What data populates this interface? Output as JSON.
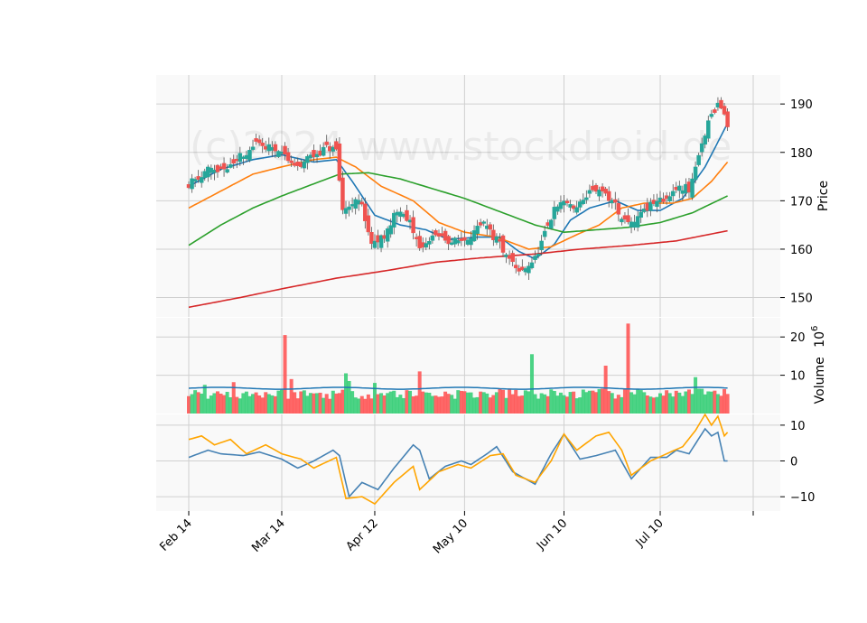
{
  "watermark": "(c)2024 www.stockdroid.de",
  "colors": {
    "up": "#26a69a",
    "down": "#ef5350",
    "up_fill": "#2ecc71",
    "down_fill": "#ff4d4d",
    "ma_fast": "#1f77b4",
    "ma_mid": "#ff7f0e",
    "ma_slow": "#2ca02c",
    "ma_long": "#d62728",
    "vol_ma": "#1f77b4",
    "osc_fast": "#4682b4",
    "osc_slow": "#ffa500",
    "panel_bg": "#f9f9f9",
    "grid": "#d0d0d0"
  },
  "chart_data": [
    {
      "type": "candlestick",
      "panel": "price",
      "ylabel": "Price",
      "ylim": [
        146,
        196
      ],
      "yticks": [
        150,
        160,
        170,
        180,
        190
      ],
      "x_range": [
        "2024-02-14",
        "2024-07-31"
      ],
      "xticks": [
        {
          "date": "2024-02-14",
          "label": "Feb 14"
        },
        {
          "date": "2024-03-14",
          "label": "Mar 14"
        },
        {
          "date": "2024-04-12",
          "label": "Apr 12"
        },
        {
          "date": "2024-05-10",
          "label": "May 10"
        },
        {
          "date": "2024-06-10",
          "label": "Jun 10"
        },
        {
          "date": "2024-07-10",
          "label": "Jul 10"
        },
        {
          "date": "2024-08-08",
          "label": ""
        }
      ],
      "close_keypoints": [
        [
          "2024-02-14",
          173.5
        ],
        [
          "2024-02-20",
          176.5
        ],
        [
          "2024-02-26",
          176.0
        ],
        [
          "2024-03-01",
          179.0
        ],
        [
          "2024-03-06",
          181.5
        ],
        [
          "2024-03-11",
          181.0
        ],
        [
          "2024-03-14",
          180.0
        ],
        [
          "2024-03-19",
          177.0
        ],
        [
          "2024-03-22",
          178.5
        ],
        [
          "2024-03-28",
          181.0
        ],
        [
          "2024-03-31",
          180.5
        ],
        [
          "2024-04-02",
          168.0
        ],
        [
          "2024-04-05",
          170.0
        ],
        [
          "2024-04-08",
          169.5
        ],
        [
          "2024-04-11",
          160.5
        ],
        [
          "2024-04-15",
          163.0
        ],
        [
          "2024-04-19",
          168.0
        ],
        [
          "2024-04-23",
          166.0
        ],
        [
          "2024-04-26",
          160.0
        ],
        [
          "2024-05-01",
          163.0
        ],
        [
          "2024-05-06",
          161.5
        ],
        [
          "2024-05-10",
          162.0
        ],
        [
          "2024-05-16",
          165.0
        ],
        [
          "2024-05-21",
          161.0
        ],
        [
          "2024-05-25",
          157.0
        ],
        [
          "2024-05-28",
          155.5
        ],
        [
          "2024-06-01",
          158.0
        ],
        [
          "2024-06-04",
          163.0
        ],
        [
          "2024-06-07",
          168.0
        ],
        [
          "2024-06-10",
          170.0
        ],
        [
          "2024-06-14",
          168.5
        ],
        [
          "2024-06-18",
          172.0
        ],
        [
          "2024-06-22",
          171.5
        ],
        [
          "2024-06-26",
          170.0
        ],
        [
          "2024-06-28",
          166.0
        ],
        [
          "2024-07-01",
          165.0
        ],
        [
          "2024-07-05",
          168.0
        ],
        [
          "2024-07-09",
          170.0
        ],
        [
          "2024-07-12",
          170.5
        ],
        [
          "2024-07-16",
          173.0
        ],
        [
          "2024-07-19",
          172.5
        ],
        [
          "2024-07-22",
          180.0
        ],
        [
          "2024-07-25",
          186.0
        ],
        [
          "2024-07-28",
          190.0
        ],
        [
          "2024-07-31",
          186.0
        ]
      ],
      "moving_averages": [
        {
          "color_key": "ma_fast",
          "points": [
            [
              "2024-02-14",
              173.0
            ],
            [
              "2024-02-24",
              176.5
            ],
            [
              "2024-03-05",
              178.5
            ],
            [
              "2024-03-14",
              179.5
            ],
            [
              "2024-03-24",
              178.0
            ],
            [
              "2024-03-31",
              178.5
            ],
            [
              "2024-04-05",
              174.0
            ],
            [
              "2024-04-12",
              167.0
            ],
            [
              "2024-04-20",
              165.0
            ],
            [
              "2024-04-28",
              164.0
            ],
            [
              "2024-05-05",
              162.0
            ],
            [
              "2024-05-14",
              162.5
            ],
            [
              "2024-05-21",
              162.5
            ],
            [
              "2024-05-27",
              159.5
            ],
            [
              "2024-06-01",
              158.0
            ],
            [
              "2024-06-07",
              161.0
            ],
            [
              "2024-06-12",
              166.0
            ],
            [
              "2024-06-18",
              168.5
            ],
            [
              "2024-06-26",
              170.0
            ],
            [
              "2024-07-03",
              168.0
            ],
            [
              "2024-07-10",
              168.0
            ],
            [
              "2024-07-17",
              170.5
            ],
            [
              "2024-07-24",
              177.0
            ],
            [
              "2024-07-31",
              186.0
            ]
          ]
        },
        {
          "color_key": "ma_mid",
          "points": [
            [
              "2024-02-14",
              168.5
            ],
            [
              "2024-02-24",
              172.0
            ],
            [
              "2024-03-05",
              175.5
            ],
            [
              "2024-03-14",
              177.0
            ],
            [
              "2024-03-24",
              178.5
            ],
            [
              "2024-03-31",
              179.0
            ],
            [
              "2024-04-06",
              177.0
            ],
            [
              "2024-04-14",
              173.0
            ],
            [
              "2024-04-24",
              170.0
            ],
            [
              "2024-05-02",
              165.5
            ],
            [
              "2024-05-10",
              163.5
            ],
            [
              "2024-05-20",
              162.5
            ],
            [
              "2024-05-30",
              160.0
            ],
            [
              "2024-06-06",
              160.5
            ],
            [
              "2024-06-14",
              163.0
            ],
            [
              "2024-06-21",
              165.0
            ],
            [
              "2024-06-28",
              168.5
            ],
            [
              "2024-07-05",
              169.5
            ],
            [
              "2024-07-14",
              169.5
            ],
            [
              "2024-07-20",
              170.5
            ],
            [
              "2024-07-26",
              174.0
            ],
            [
              "2024-07-31",
              178.0
            ]
          ]
        },
        {
          "color_key": "ma_slow",
          "points": [
            [
              "2024-02-14",
              160.8
            ],
            [
              "2024-02-24",
              165.0
            ],
            [
              "2024-03-05",
              168.5
            ],
            [
              "2024-03-14",
              171.0
            ],
            [
              "2024-03-24",
              173.5
            ],
            [
              "2024-04-01",
              175.5
            ],
            [
              "2024-04-10",
              175.8
            ],
            [
              "2024-04-20",
              174.5
            ],
            [
              "2024-04-30",
              172.5
            ],
            [
              "2024-05-10",
              170.5
            ],
            [
              "2024-05-20",
              168.0
            ],
            [
              "2024-06-01",
              165.0
            ],
            [
              "2024-06-10",
              163.5
            ],
            [
              "2024-06-20",
              164.0
            ],
            [
              "2024-06-30",
              164.5
            ],
            [
              "2024-07-10",
              165.5
            ],
            [
              "2024-07-20",
              167.5
            ],
            [
              "2024-07-31",
              171.0
            ]
          ]
        },
        {
          "color_key": "ma_long",
          "points": [
            [
              "2024-02-14",
              148.0
            ],
            [
              "2024-03-01",
              150.0
            ],
            [
              "2024-03-14",
              151.8
            ],
            [
              "2024-03-31",
              154.0
            ],
            [
              "2024-04-15",
              155.5
            ],
            [
              "2024-05-01",
              157.3
            ],
            [
              "2024-05-15",
              158.2
            ],
            [
              "2024-06-01",
              159.0
            ],
            [
              "2024-06-15",
              160.0
            ],
            [
              "2024-07-01",
              160.8
            ],
            [
              "2024-07-15",
              161.7
            ],
            [
              "2024-07-31",
              163.8
            ]
          ]
        }
      ]
    },
    {
      "type": "bar",
      "panel": "volume",
      "ylabel": "Volume",
      "ylabel_exponent": "10^6",
      "ylim": [
        0,
        25
      ],
      "yticks": [
        10,
        20
      ],
      "baseline_level": 5,
      "spikes": [
        [
          "2024-02-19",
          7.5
        ],
        [
          "2024-02-28",
          8.2
        ],
        [
          "2024-03-15",
          20.5
        ],
        [
          "2024-03-17",
          9.0
        ],
        [
          "2024-04-03",
          10.5
        ],
        [
          "2024-04-04",
          8.5
        ],
        [
          "2024-04-12",
          8.0
        ],
        [
          "2024-04-26",
          11.0
        ],
        [
          "2024-05-31",
          15.5
        ],
        [
          "2024-06-23",
          12.5
        ],
        [
          "2024-06-30",
          23.5
        ],
        [
          "2024-07-21",
          9.5
        ]
      ],
      "volume_ma": 6.6
    },
    {
      "type": "line",
      "panel": "oscillator",
      "ylim": [
        -14,
        13
      ],
      "yticks": [
        -10,
        0,
        10
      ],
      "series": [
        {
          "color_key": "osc_fast",
          "points": [
            [
              "2024-02-14",
              1.0
            ],
            [
              "2024-02-20",
              3.0
            ],
            [
              "2024-02-24",
              2.0
            ],
            [
              "2024-03-02",
              1.5
            ],
            [
              "2024-03-07",
              2.5
            ],
            [
              "2024-03-14",
              0.5
            ],
            [
              "2024-03-19",
              -2.0
            ],
            [
              "2024-03-24",
              0.0
            ],
            [
              "2024-03-30",
              3.0
            ],
            [
              "2024-04-01",
              1.5
            ],
            [
              "2024-04-04",
              -10.0
            ],
            [
              "2024-04-08",
              -6.0
            ],
            [
              "2024-04-13",
              -8.0
            ],
            [
              "2024-04-18",
              -2.0
            ],
            [
              "2024-04-24",
              4.5
            ],
            [
              "2024-04-26",
              3.0
            ],
            [
              "2024-04-29",
              -5.0
            ],
            [
              "2024-05-04",
              -1.5
            ],
            [
              "2024-05-09",
              0.0
            ],
            [
              "2024-05-12",
              -1.0
            ],
            [
              "2024-05-17",
              2.0
            ],
            [
              "2024-05-20",
              4.0
            ],
            [
              "2024-05-25",
              -3.0
            ],
            [
              "2024-06-01",
              -6.5
            ],
            [
              "2024-06-06",
              2.0
            ],
            [
              "2024-06-10",
              7.5
            ],
            [
              "2024-06-15",
              0.5
            ],
            [
              "2024-06-20",
              1.5
            ],
            [
              "2024-06-26",
              3.0
            ],
            [
              "2024-07-01",
              -5.0
            ],
            [
              "2024-07-07",
              1.0
            ],
            [
              "2024-07-12",
              1.0
            ],
            [
              "2024-07-15",
              3.0
            ],
            [
              "2024-07-19",
              2.0
            ],
            [
              "2024-07-24",
              9.0
            ],
            [
              "2024-07-26",
              7.0
            ],
            [
              "2024-07-28",
              8.0
            ],
            [
              "2024-07-30",
              0.0
            ],
            [
              "2024-07-31",
              0.0
            ]
          ]
        },
        {
          "color_key": "osc_slow",
          "points": [
            [
              "2024-02-14",
              6.0
            ],
            [
              "2024-02-18",
              7.0
            ],
            [
              "2024-02-22",
              4.5
            ],
            [
              "2024-02-27",
              6.0
            ],
            [
              "2024-03-03",
              2.0
            ],
            [
              "2024-03-09",
              4.5
            ],
            [
              "2024-03-14",
              2.0
            ],
            [
              "2024-03-20",
              0.5
            ],
            [
              "2024-03-24",
              -2.0
            ],
            [
              "2024-03-31",
              1.0
            ],
            [
              "2024-04-03",
              -10.5
            ],
            [
              "2024-04-08",
              -10.0
            ],
            [
              "2024-04-12",
              -12.0
            ],
            [
              "2024-04-18",
              -6.0
            ],
            [
              "2024-04-24",
              -1.5
            ],
            [
              "2024-04-26",
              -8.0
            ],
            [
              "2024-05-02",
              -3.0
            ],
            [
              "2024-05-08",
              -1.0
            ],
            [
              "2024-05-12",
              -2.0
            ],
            [
              "2024-05-18",
              1.5
            ],
            [
              "2024-05-22",
              2.0
            ],
            [
              "2024-05-26",
              -4.0
            ],
            [
              "2024-06-01",
              -6.0
            ],
            [
              "2024-06-06",
              0.0
            ],
            [
              "2024-06-10",
              7.5
            ],
            [
              "2024-06-14",
              3.0
            ],
            [
              "2024-06-20",
              7.0
            ],
            [
              "2024-06-24",
              8.0
            ],
            [
              "2024-06-28",
              3.0
            ],
            [
              "2024-07-01",
              -4.0
            ],
            [
              "2024-07-07",
              0.0
            ],
            [
              "2024-07-12",
              2.0
            ],
            [
              "2024-07-17",
              4.0
            ],
            [
              "2024-07-21",
              8.5
            ],
            [
              "2024-07-24",
              13.0
            ],
            [
              "2024-07-26",
              10.0
            ],
            [
              "2024-07-28",
              12.5
            ],
            [
              "2024-07-30",
              7.0
            ],
            [
              "2024-07-31",
              8.0
            ]
          ]
        }
      ]
    }
  ]
}
